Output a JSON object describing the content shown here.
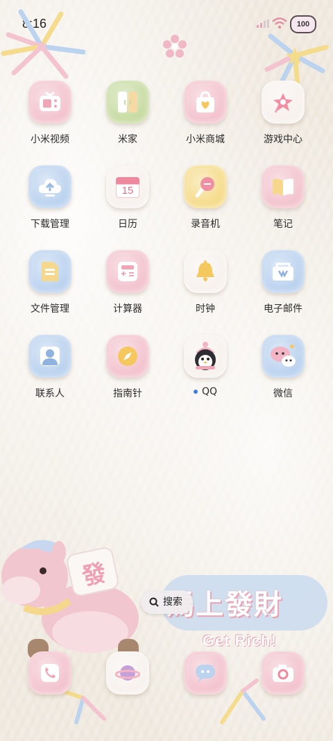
{
  "status_bar": {
    "time": "8:16",
    "battery": "100"
  },
  "apps": [
    {
      "label": "小米视频",
      "icon": "tv-icon",
      "color": "pink"
    },
    {
      "label": "米家",
      "icon": "door-panel-icon",
      "color": "green"
    },
    {
      "label": "小米商城",
      "icon": "shopping-bag-icon",
      "color": "pink"
    },
    {
      "label": "游戏中心",
      "icon": "pinwheel-icon",
      "color": "white"
    },
    {
      "label": "下载管理",
      "icon": "cloud-download-icon",
      "color": "blue"
    },
    {
      "label": "日历",
      "icon": "calendar-icon",
      "color": "white",
      "day": "15"
    },
    {
      "label": "录音机",
      "icon": "microphone-icon",
      "color": "yellow"
    },
    {
      "label": "笔记",
      "icon": "notebook-icon",
      "color": "pink"
    },
    {
      "label": "文件管理",
      "icon": "folder-icon",
      "color": "blue"
    },
    {
      "label": "计算器",
      "icon": "calculator-icon",
      "color": "pink"
    },
    {
      "label": "时钟",
      "icon": "bell-icon",
      "color": "white"
    },
    {
      "label": "电子邮件",
      "icon": "mail-box-icon",
      "color": "blue"
    },
    {
      "label": "联系人",
      "icon": "contact-person-icon",
      "color": "blue"
    },
    {
      "label": "指南针",
      "icon": "compass-icon",
      "color": "pink"
    },
    {
      "label": "QQ",
      "icon": "penguin-icon",
      "color": "white"
    },
    {
      "label": "微信",
      "icon": "chat-bubbles-icon",
      "color": "blue"
    }
  ],
  "search": {
    "label": "搜索"
  },
  "banner": {
    "title": "馬上發財",
    "subtitle": "Get Rich!",
    "horse_badge": "發"
  },
  "dock": [
    {
      "icon": "phone-icon",
      "color": "pink"
    },
    {
      "icon": "planet-browser-icon",
      "color": "white"
    },
    {
      "icon": "message-bubble-icon",
      "color": "pink"
    },
    {
      "icon": "camera-icon",
      "color": "pink"
    }
  ]
}
